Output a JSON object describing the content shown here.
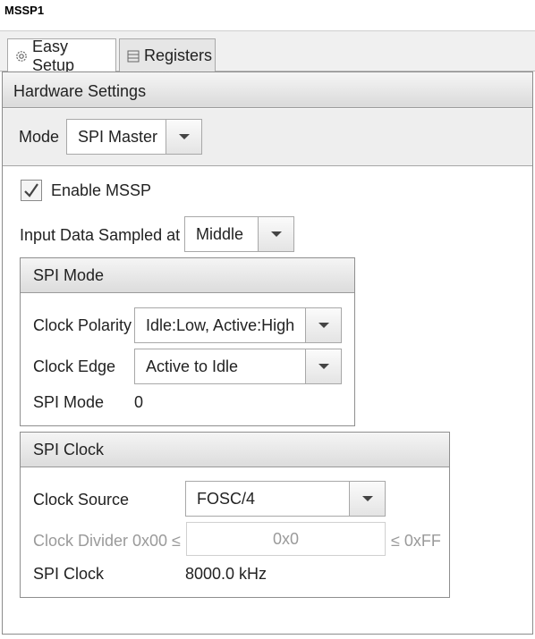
{
  "window": {
    "title": "MSSP1"
  },
  "tabs": [
    {
      "label": "Easy Setup",
      "icon": "gear-icon",
      "active": true
    },
    {
      "label": "Registers",
      "icon": "list-icon",
      "active": false
    }
  ],
  "hardware_settings": {
    "title": "Hardware Settings",
    "mode": {
      "label": "Mode",
      "value": "SPI Master"
    },
    "enable": {
      "label": "Enable MSSP",
      "checked": true
    },
    "input_sampled": {
      "label": "Input Data Sampled at",
      "value": "Middle"
    }
  },
  "spi_mode": {
    "title": "SPI Mode",
    "clock_polarity": {
      "label": "Clock Polarity",
      "value": "Idle:Low, Active:High"
    },
    "clock_edge": {
      "label": "Clock Edge",
      "value": "Active to Idle"
    },
    "spi_mode": {
      "label": "SPI Mode",
      "value": "0"
    }
  },
  "spi_clock": {
    "title": "SPI Clock",
    "clock_source": {
      "label": "Clock Source",
      "value": "FOSC/4"
    },
    "clock_divider": {
      "label": "Clock Divider 0x00 ≤",
      "value": "0x0",
      "max_label": "≤ 0xFF"
    },
    "spi_clock": {
      "label": "SPI Clock",
      "value": "8000.0 kHz"
    }
  }
}
